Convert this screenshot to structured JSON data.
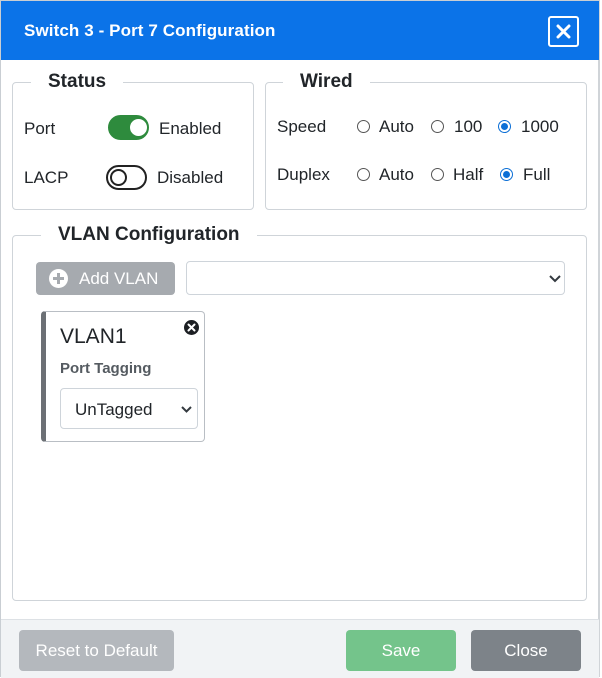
{
  "dialog": {
    "title": "Switch 3 - Port 7 Configuration"
  },
  "status": {
    "legend": "Status",
    "port": {
      "label": "Port",
      "enabled": true,
      "state_label": "Enabled"
    },
    "lacp": {
      "label": "LACP",
      "enabled": false,
      "state_label": "Disabled"
    }
  },
  "wired": {
    "legend": "Wired",
    "speed": {
      "label": "Speed",
      "options": [
        "Auto",
        "100",
        "1000"
      ],
      "selected": "1000"
    },
    "duplex": {
      "label": "Duplex",
      "options": [
        "Auto",
        "Half",
        "Full"
      ],
      "selected": "Full"
    }
  },
  "vlan_config": {
    "legend": "VLAN Configuration",
    "add_button_label": "Add VLAN",
    "vlan_select_value": "",
    "vlans": [
      {
        "name": "VLAN1",
        "tagging_label": "Port Tagging",
        "tagging_value": "UnTagged"
      }
    ]
  },
  "footer": {
    "reset_label": "Reset to Default",
    "save_label": "Save",
    "close_label": "Close"
  },
  "colors": {
    "header": "#0b73e8",
    "toggle_on": "#2e8b3d",
    "radio_checked": "#0b6fd6",
    "save": "#74c48b",
    "close": "#7d8389",
    "reset": "#b4b8bd"
  }
}
